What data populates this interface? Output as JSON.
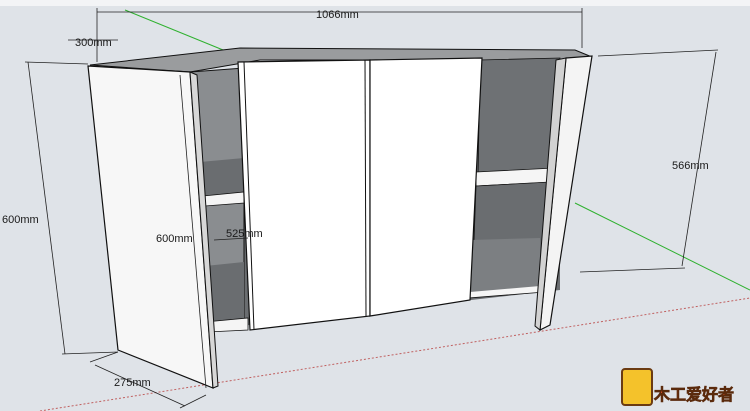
{
  "dimensions": {
    "width_top": "1066mm",
    "depth_top": "300mm",
    "height_left": "600mm",
    "height_door": "600mm",
    "shelf_width": "525mm",
    "height_right": "566mm",
    "depth_bottom": "275mm"
  },
  "watermark": {
    "text": "木工爱好者"
  },
  "colors": {
    "background": "#dfe3e8",
    "panel_face": "#ffffff",
    "interior_shade": "#6a6d70",
    "edge": "#111111",
    "green_axis": "#2fb12f",
    "red_axis": "#c06060"
  }
}
